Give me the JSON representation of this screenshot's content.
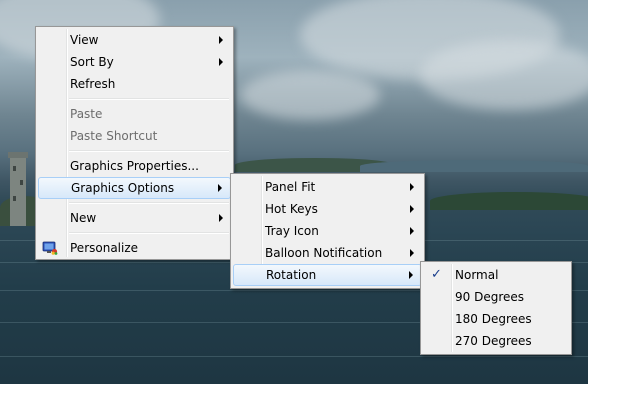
{
  "context_menu": {
    "items": {
      "view": "View",
      "sort_by": "Sort By",
      "refresh": "Refresh",
      "paste": "Paste",
      "paste_shortcut": "Paste Shortcut",
      "graphics_properties": "Graphics Properties...",
      "graphics_options": "Graphics Options",
      "new": "New",
      "personalize": "Personalize"
    }
  },
  "graphics_options_menu": {
    "items": {
      "panel_fit": "Panel Fit",
      "hot_keys": "Hot Keys",
      "tray_icon": "Tray Icon",
      "balloon_notification": "Balloon Notification",
      "rotation": "Rotation"
    }
  },
  "rotation_menu": {
    "checked": "Normal",
    "items": {
      "normal": "Normal",
      "deg_90": "90 Degrees",
      "deg_180": "180 Degrees",
      "deg_270": "270 Degrees"
    }
  },
  "icons": {
    "personalize": "personalize-display-icon",
    "check": "checkmark-icon",
    "submenu": "chevron-right-icon"
  },
  "colors": {
    "menu_bg": "#f0f0f0",
    "highlight_border": "#a8cff7",
    "checkmark": "#1a3e8c"
  }
}
